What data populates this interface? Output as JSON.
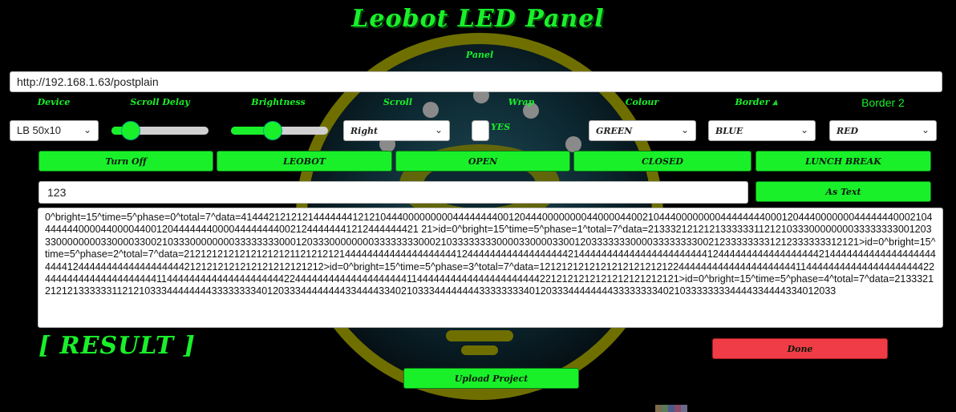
{
  "app": {
    "title": "Leobot LED Panel",
    "panel_label": "Panel",
    "url": "http://192.168.1.63/postplain"
  },
  "labels": {
    "device": "Device",
    "scroll_delay": "Scroll Delay",
    "brightness": "Brightness",
    "scroll": "Scroll",
    "wrap": "Wrap",
    "colour": "Colour",
    "border": "Border",
    "border2": "Border 2"
  },
  "controls": {
    "device": "LB 50x10",
    "scroll_delay_level": 0.12,
    "brightness_level": 0.4,
    "scroll": "Right",
    "wrap_checkbox_label": "YES",
    "colour": "GREEN",
    "border": "BLUE",
    "border2": "RED"
  },
  "buttons": {
    "turn_off": "Turn Off",
    "leobot": "LEOBOT",
    "open": "OPEN",
    "closed": "CLOSED",
    "lunch_break": "LUNCH BREAK",
    "as_text": "As Text",
    "done": "Done",
    "upload_project": "Upload Project"
  },
  "text_input": {
    "value": "123"
  },
  "output": "0^bright=15^time=5^phase=0^total=7^data=41444212121214444444121210444000000000444444440012044400000000440000440021044400000000444444440001204440000000444444400021044444440000440000440012044444440000444444440021244444441212444444421 21>id=0^bright=15^time=5^phase=1^total=7^data=21333212121213333331121210333000000003333333300120333000000003300003300210333000000003333333300012033300000000333333330002103333333300003300003300120333333300003333333300212333333331212333333312121>id=0^bright=15^time=5^phase=2^total=7^data=21212121212121212121121212121444444444444444444441244444444444444444421444444444444444444444441244444444444444444421444444444444444444444441244444444444444444442121212121212121212121212>id=0^bright=15^time=5^phase=3^total=7^data=12121212121212121212121224444444444444444444441144444444444444444444422444444444444444444441144444444444444444444422444444444444444444441144444444444444444444442212121212121212121212121>id=0^bright=15^time=5^phase=4^total=7^data=21333212121213333331121210333444444443333333340120333444444443344443340210333444444443333333340120333444444443333333340210333333334444334444334012033",
  "result_label": "[ RESULT ]",
  "colors": {
    "accent": "#19f02a",
    "danger": "#f03c46",
    "ring": "#7a7a00"
  }
}
